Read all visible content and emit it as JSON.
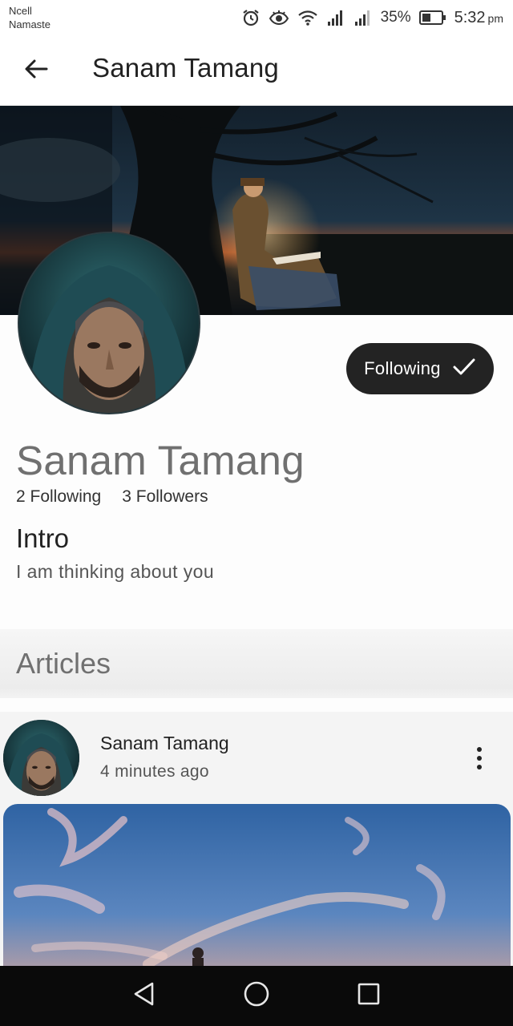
{
  "status_bar": {
    "carrier_line1": "Ncell",
    "carrier_line2": "Namaste",
    "battery_percent": "35%",
    "time": "5:32",
    "ampm": "pm",
    "icons": [
      "alarm-icon",
      "eye-icon",
      "wifi-icon",
      "signal-icon",
      "signal-icon",
      "battery-icon"
    ]
  },
  "app_bar": {
    "back_icon": "arrow-left-icon",
    "title": "Sanam Tamang"
  },
  "profile": {
    "name": "Sanam Tamang",
    "following_count": "2 Following",
    "followers_count": "3 Followers",
    "follow_button_label": "Following",
    "follow_button_icon": "checkmark-icon",
    "intro_title": "Intro",
    "intro_text": "I am thinking about you"
  },
  "articles": {
    "header": "Articles",
    "posts": [
      {
        "author": "Sanam Tamang",
        "time": "4 minutes ago",
        "menu_icon": "more-vertical-icon"
      }
    ]
  },
  "nav_bar": {
    "icons": [
      "back-triangle-icon",
      "home-circle-icon",
      "recents-square-icon"
    ]
  },
  "colors": {
    "follow_button_bg": "#232323",
    "profile_name": "#707070",
    "articles_header": "#707070",
    "nav_bar_bg": "#0a0a0a"
  }
}
